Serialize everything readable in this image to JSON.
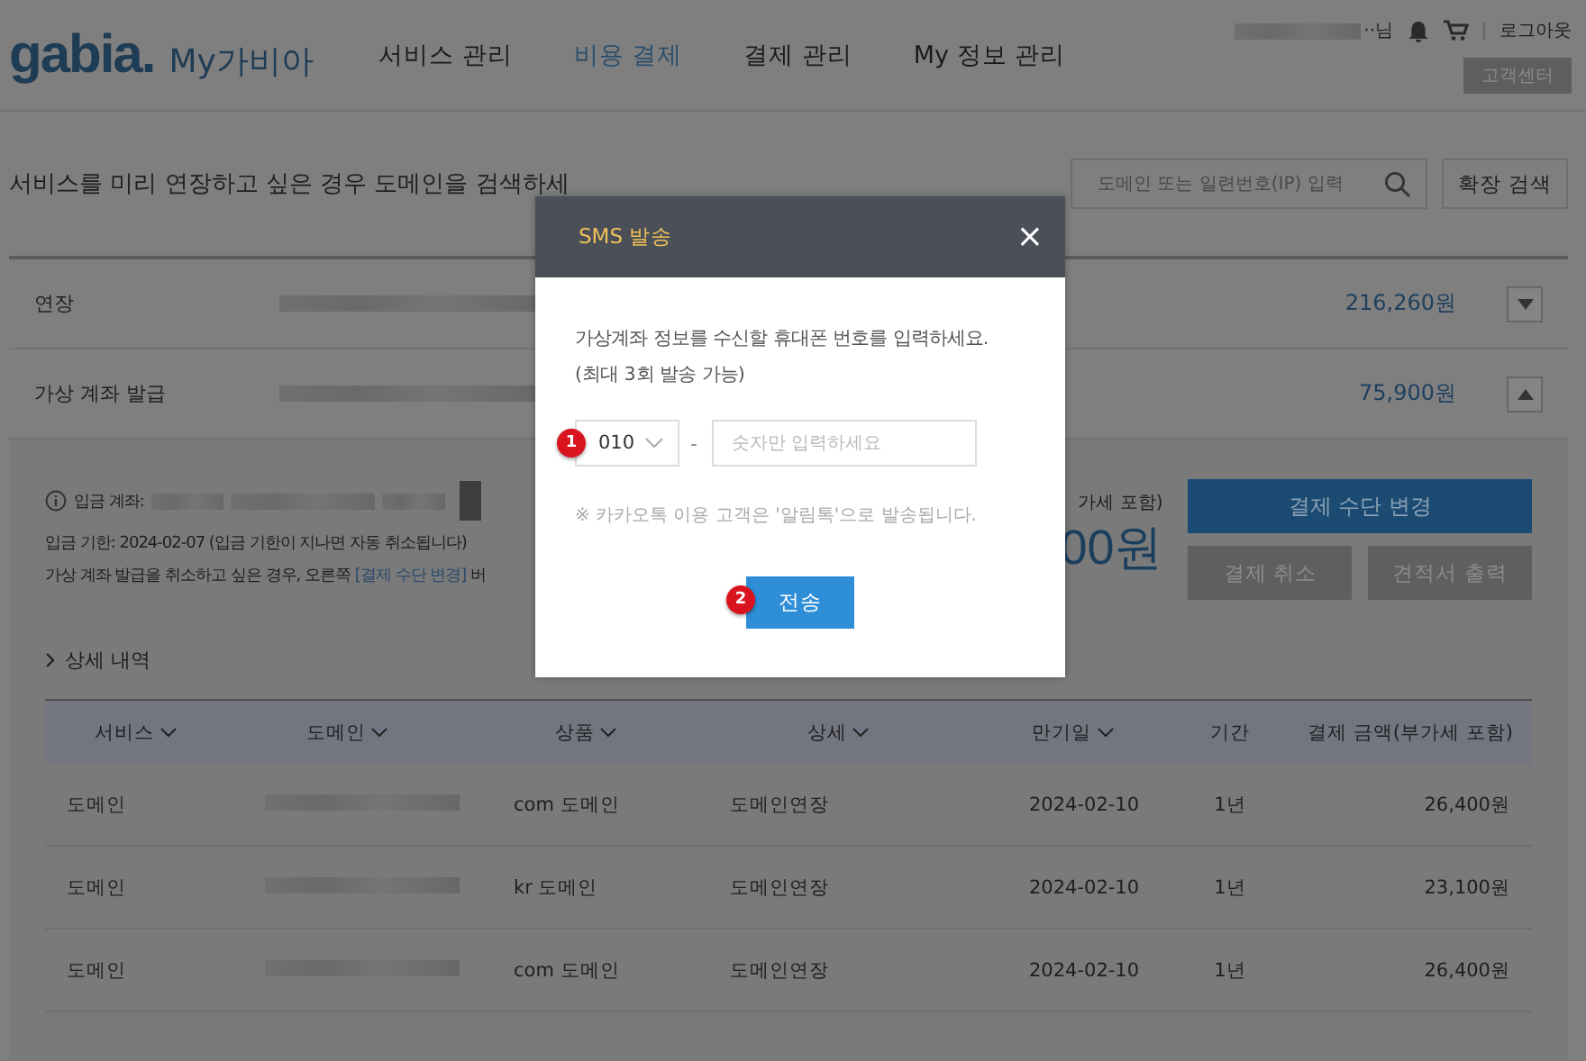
{
  "header": {
    "logo": "gabia.",
    "logo_suffix": "My가비아",
    "nav": [
      {
        "label": "서비스 관리",
        "selected": false
      },
      {
        "label": "비용 결제",
        "selected": true
      },
      {
        "label": "결제 관리",
        "selected": false
      },
      {
        "label": "My 정보 관리",
        "selected": false
      }
    ],
    "user_suffix": "··님",
    "logout": "로그아웃",
    "support": "고객센터"
  },
  "search_hint": "서비스를 미리 연장하고 싶은 경우 도메인을 검색하세",
  "search": {
    "placeholder": "도메인 또는 일련번호(IP) 입력",
    "button": "확장 검색"
  },
  "summary_rows": [
    {
      "label": "연장",
      "amount": "216,260원",
      "expanded": false
    },
    {
      "label": "가상 계좌 발급",
      "amount": "75,900원",
      "expanded": true
    }
  ],
  "deposit": {
    "account_label": "입금 계좌:",
    "deadline": "입금 기한: 2024-02-07 (입금 기한이 지나면 자동 취소됩니다)",
    "cancel_before": "가상 계좌 발급을 취소하고 싶은 경우, 오른쪽 ",
    "cancel_link": "[결제 수단 변경]",
    "cancel_after": " 버",
    "total_label": "가세 포함)",
    "total": "00원",
    "change_button": "결제 수단 변경",
    "cancel_button": "결제 취소",
    "quote_button": "견적서 출력"
  },
  "details_toggle": "상세 내역",
  "table": {
    "columns": [
      {
        "label": "서비스",
        "sortable": true
      },
      {
        "label": "도메인",
        "sortable": true
      },
      {
        "label": "상품",
        "sortable": true
      },
      {
        "label": "상세",
        "sortable": true
      },
      {
        "label": "만기일",
        "sortable": true
      },
      {
        "label": "기간",
        "sortable": false
      },
      {
        "label": "결제 금액(부가세 포함)",
        "sortable": false
      }
    ],
    "rows": [
      {
        "service": "도메인",
        "product": "com 도메인",
        "detail": "도메인연장",
        "expiry": "2024-02-10",
        "period": "1년",
        "amount": "26,400원"
      },
      {
        "service": "도메인",
        "product": "kr 도메인",
        "detail": "도메인연장",
        "expiry": "2024-02-10",
        "period": "1년",
        "amount": "23,100원"
      },
      {
        "service": "도메인",
        "product": "com 도메인",
        "detail": "도메인연장",
        "expiry": "2024-02-10",
        "period": "1년",
        "amount": "26,400원"
      }
    ]
  },
  "modal": {
    "title": "SMS 발송",
    "close": "×",
    "message": "가상계좌 정보를 수신할 휴대폰 번호를 입력하세요.",
    "limit": "(최대 3회 발송 가능)",
    "prefix": "010",
    "dash": "-",
    "phone_placeholder": "숫자만 입력하세요",
    "notice": "※ 카카오톡 이용 고객은 '알림톡'으로 발송됩니다.",
    "send": "전송",
    "step_marks": [
      "1",
      "2"
    ]
  }
}
